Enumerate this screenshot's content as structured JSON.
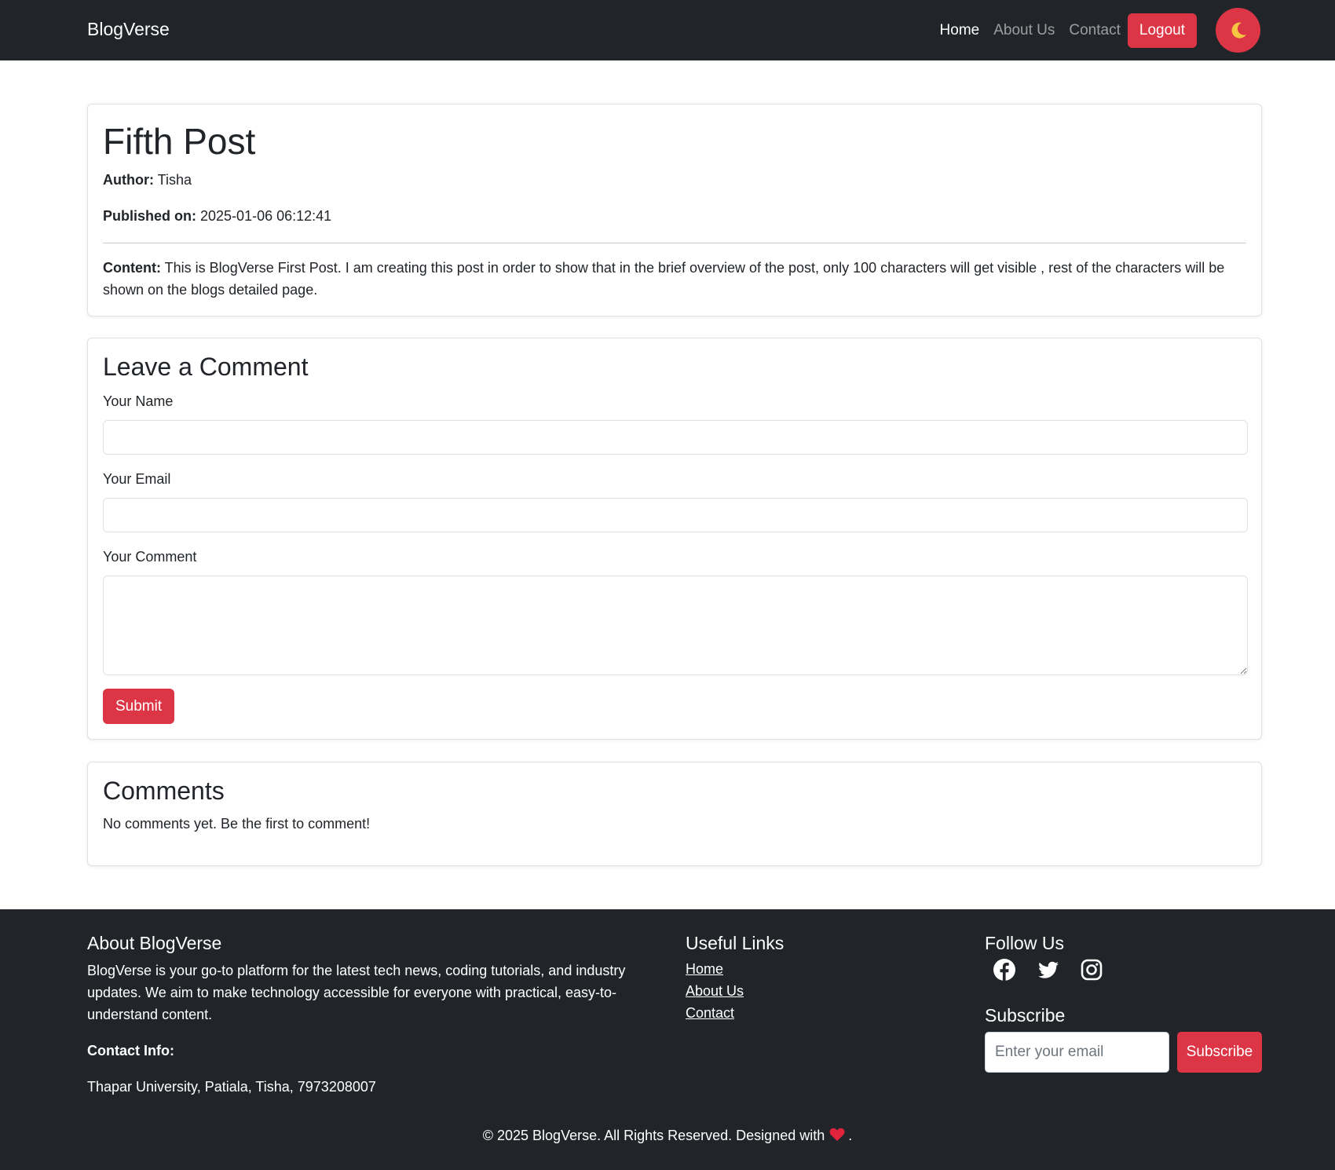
{
  "navbar": {
    "brand": "BlogVerse",
    "links": [
      "Home",
      "About Us",
      "Contact"
    ],
    "logout_label": "Logout",
    "theme_toggle_icon": "moon-icon"
  },
  "post": {
    "title": "Fifth Post",
    "author_label": "Author:",
    "author": "Tisha",
    "published_label": "Published on:",
    "published": "2025-01-06 06:12:41",
    "content_label": "Content:",
    "content": "This is BlogVerse First Post. I am creating this post in order to show that in the brief overview of the post, only 100 characters will get visible , rest of the characters will be shown on the blogs detailed page."
  },
  "comment_form": {
    "title": "Leave a Comment",
    "name_label": "Your Name",
    "name_value": "",
    "email_label": "Your Email",
    "email_value": "",
    "comment_label": "Your Comment",
    "comment_value": "",
    "submit_label": "Submit"
  },
  "comments": {
    "title": "Comments",
    "empty_text": "No comments yet. Be the first to comment!"
  },
  "footer": {
    "about_title": "About BlogVerse",
    "about_text": "BlogVerse is your go-to platform for the latest tech news, coding tutorials, and industry updates. We aim to make technology accessible for everyone with practical, easy-to-understand content.",
    "contact_label": "Contact Info:",
    "contact_text": "Thapar University, Patiala, Tisha, 7973208007",
    "links_title": "Useful Links",
    "links": [
      "Home",
      "About Us",
      "Contact"
    ],
    "follow_title": "Follow Us",
    "social_icons": [
      "facebook-icon",
      "twitter-icon",
      "instagram-icon"
    ],
    "subscribe_title": "Subscribe",
    "subscribe_placeholder": "Enter your email",
    "subscribe_label": "Subscribe",
    "copyright_text": "© 2025 BlogVerse. All Rights Reserved. Designed with",
    "copyright_end": "."
  },
  "colors": {
    "dark": "#212529",
    "accent": "#dc3545",
    "moon": "#f5c542"
  }
}
